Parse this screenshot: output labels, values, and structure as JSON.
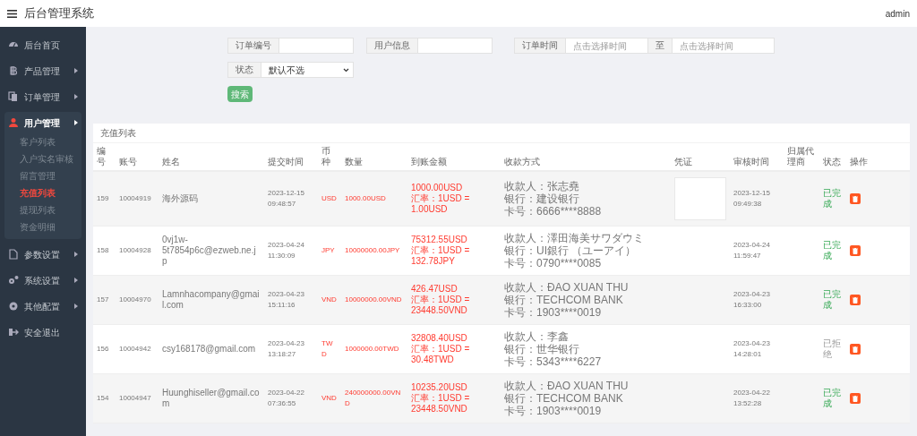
{
  "header": {
    "title": "后台管理系统",
    "user": "admin"
  },
  "sidebar": {
    "items": [
      {
        "label": "后台首页",
        "expandable": false,
        "expanded": false
      },
      {
        "label": "产品管理",
        "expandable": true,
        "expanded": false
      },
      {
        "label": "订单管理",
        "expandable": true,
        "expanded": false
      },
      {
        "label": "用户管理",
        "expandable": true,
        "expanded": true,
        "children": [
          {
            "label": "客户列表",
            "selected": false
          },
          {
            "label": "入户实名审核",
            "selected": false
          },
          {
            "label": "留言管理",
            "selected": false
          },
          {
            "label": "充值列表",
            "selected": true
          },
          {
            "label": "提现列表",
            "selected": false
          },
          {
            "label": "资金明细",
            "selected": false
          }
        ]
      },
      {
        "label": "参数设置",
        "expandable": true,
        "expanded": false
      },
      {
        "label": "系统设置",
        "expandable": true,
        "expanded": false
      },
      {
        "label": "其他配置",
        "expandable": true,
        "expanded": false
      },
      {
        "label": "安全退出",
        "expandable": false,
        "expanded": false
      }
    ]
  },
  "filters": {
    "order_no": {
      "label": "订单编号"
    },
    "user_info": {
      "label": "用户信息"
    },
    "order_time": {
      "label": "订单时间",
      "from_placeholder": "点击选择时间",
      "separator": "至",
      "to_placeholder": "点击选择时间"
    },
    "status": {
      "label": "状态",
      "value": "默认不选"
    },
    "search_button": "搜索"
  },
  "table": {
    "title": "充值列表",
    "columns": [
      "编号",
      "账号",
      "姓名",
      "提交时间",
      "币种",
      "数量",
      "到账金额",
      "收款方式",
      "凭证",
      "审核时间",
      "归属代理商",
      "状态",
      "操作"
    ],
    "rows": [
      {
        "id": "159",
        "account": "10004919",
        "name": "海外源码",
        "submitted": [
          "2023-12-15",
          "09:48:57"
        ],
        "currency": "USD",
        "quantity": "1000.00USD",
        "received": [
          "1000.00USD",
          "汇率：1USD = 1.00USD"
        ],
        "payment": [
          "收款人：张志堯",
          "银行：建设银行",
          "卡号：6666****8888"
        ],
        "voucher": true,
        "reviewed": [
          "2023-12-15",
          "09:49:38"
        ],
        "status": {
          "kind": "completed",
          "text": "已完成"
        }
      },
      {
        "id": "158",
        "account": "10004928",
        "name": "0vj1w-5t7854p6c@ezweb.ne.jp",
        "submitted": [
          "2023-04-24",
          "11:30:09"
        ],
        "currency": "JPY",
        "quantity": "10000000.00JPY",
        "received": [
          "75312.55USD",
          "汇率：1USD = 132.78JPY"
        ],
        "payment": [
          "收款人：澤田海美サワダウミ",
          "银行：UI銀行 （ユーアイ）",
          "卡号：0790****0085"
        ],
        "voucher": false,
        "reviewed": [
          "2023-04-24",
          "11:59:47"
        ],
        "status": {
          "kind": "completed",
          "text": "已完成"
        }
      },
      {
        "id": "157",
        "account": "10004970",
        "name": "Lamnhacompany@gmail.com",
        "submitted": [
          "2023-04-23",
          "15:11:16"
        ],
        "currency": "VND",
        "quantity": "10000000.00VND",
        "received": [
          "426.47USD",
          "汇率：1USD = 23448.50VND"
        ],
        "payment": [
          "收款人：ĐAO XUAN THU",
          "银行：TECHCOM BANK",
          "卡号：1903****0019"
        ],
        "voucher": false,
        "reviewed": [
          "2023-04-23",
          "16:33:00"
        ],
        "status": {
          "kind": "completed",
          "text": "已完成"
        }
      },
      {
        "id": "156",
        "account": "10004942",
        "name": "csy168178@gmail.com",
        "submitted": [
          "2023-04-23",
          "13:18:27"
        ],
        "currency": "TWD",
        "quantity": "1000000.00TWD",
        "received": [
          "32808.40USD",
          "汇率：1USD = 30.48TWD"
        ],
        "payment": [
          "收款人：李鑫",
          "银行：世华银行",
          "卡号：5343****6227"
        ],
        "voucher": false,
        "reviewed": [
          "2023-04-23",
          "14:28:01"
        ],
        "status": {
          "kind": "rejected",
          "text": "已拒绝"
        }
      },
      {
        "id": "154",
        "account": "10004947",
        "name": "Huunghiseller@gmail.com",
        "submitted": [
          "2023-04-22",
          "07:36:55"
        ],
        "currency": "VND",
        "quantity": "240000000.00VND",
        "received": [
          "10235.20USD",
          "汇率：1USD = 23448.50VND"
        ],
        "payment": [
          "收款人：ĐAO XUAN THU",
          "银行：TECHCOM BANK",
          "卡号：1903****0019"
        ],
        "voucher": false,
        "reviewed": [
          "2023-04-22",
          "13:52:28"
        ],
        "status": {
          "kind": "completed",
          "text": "已完成"
        }
      }
    ]
  }
}
